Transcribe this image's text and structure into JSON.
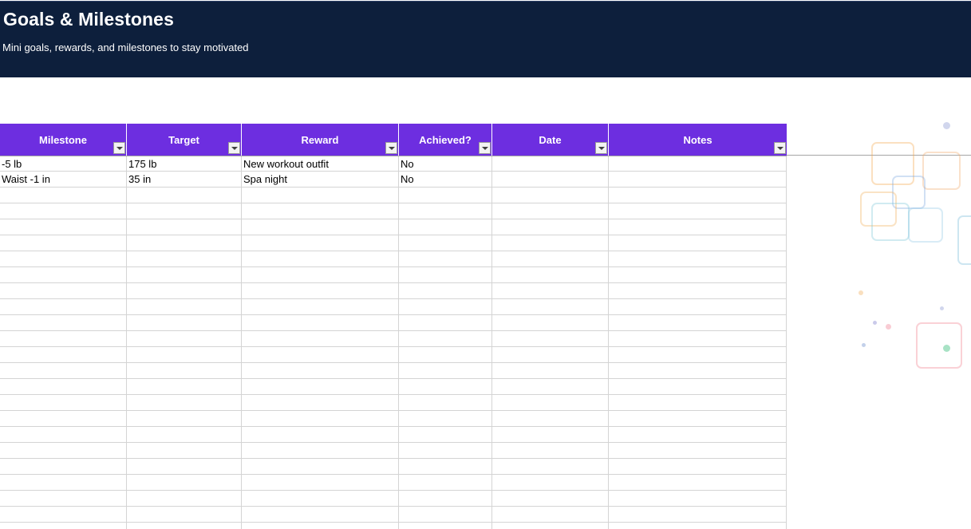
{
  "header": {
    "title": "Goals & Milestones",
    "subtitle": "Mini goals, rewards, and milestones to stay motivated"
  },
  "table": {
    "columns": [
      "Milestone",
      "Target",
      "Reward",
      "Achieved?",
      "Date",
      "Notes"
    ],
    "rows": [
      [
        "-5 lb",
        "175 lb",
        "New workout outfit",
        "No",
        "",
        ""
      ],
      [
        "Waist -1 in",
        "35 in",
        "Spa night",
        "No",
        "",
        ""
      ]
    ],
    "empty_row_count": 22
  },
  "colors": {
    "banner": "#0d1f3c",
    "header_row": "#6d2ee0",
    "grid": "#d4d4d4"
  },
  "icons": {
    "filter": "filter-dropdown-icon",
    "decoration": "question-box-icon"
  }
}
